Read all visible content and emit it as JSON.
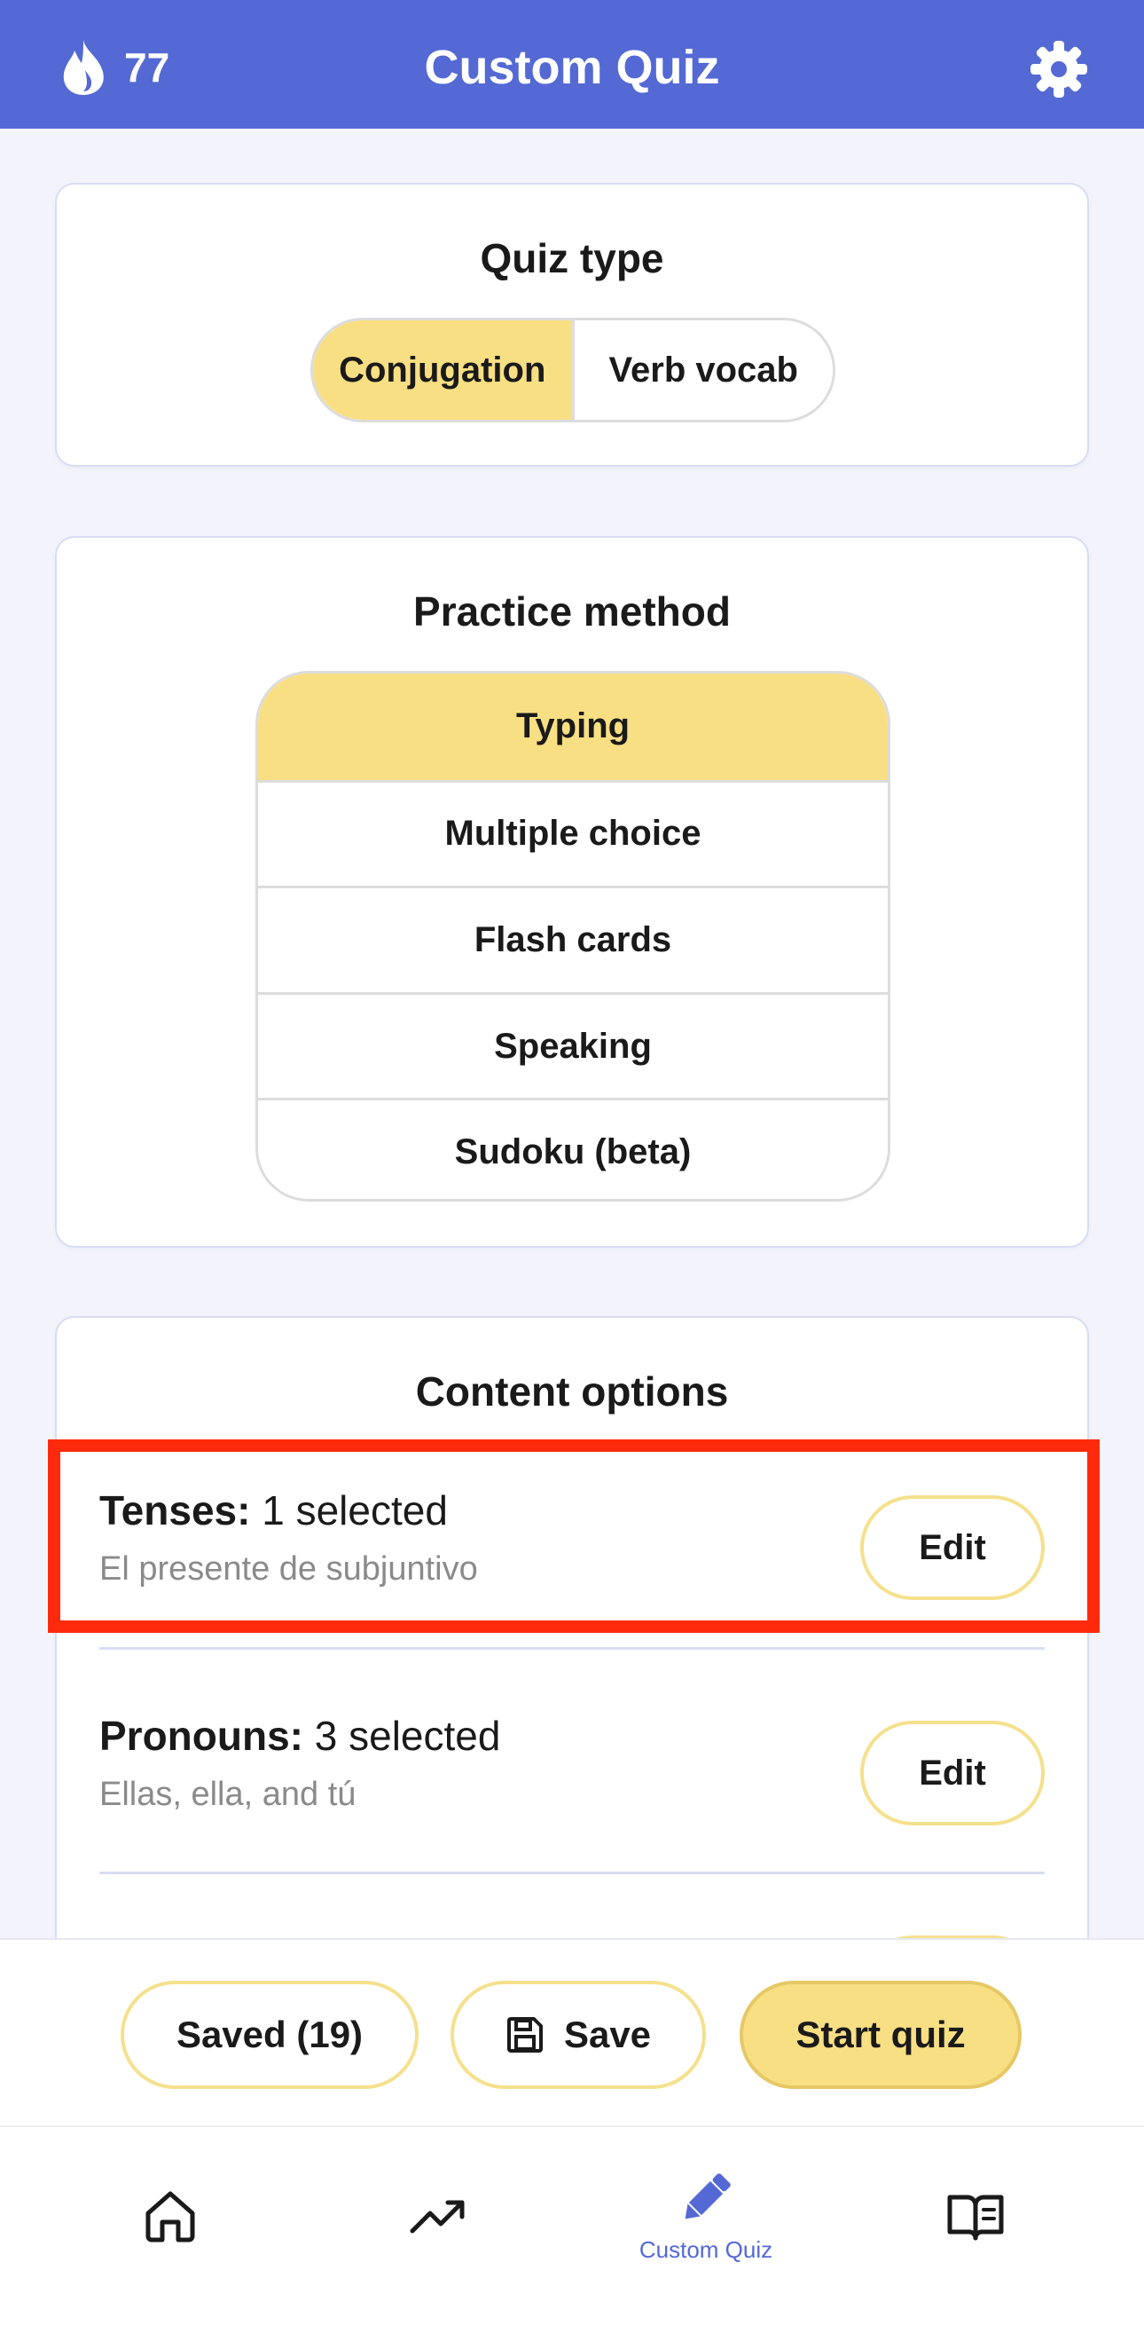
{
  "header": {
    "streak_count": "77",
    "title": "Custom Quiz"
  },
  "quiz_type": {
    "title": "Quiz type",
    "options": [
      "Conjugation",
      "Verb vocab"
    ],
    "selected": "Conjugation"
  },
  "practice_method": {
    "title": "Practice method",
    "options": [
      "Typing",
      "Multiple choice",
      "Flash cards",
      "Speaking",
      "Sudoku (beta)"
    ],
    "selected": "Typing"
  },
  "content_options": {
    "title": "Content options",
    "rows": [
      {
        "label": "Tenses:",
        "count": "1 selected",
        "detail": "El presente de subjuntivo",
        "edit": "Edit"
      },
      {
        "label": "Pronouns:",
        "count": "3 selected",
        "detail": "Ellas, ella, and tú",
        "edit": "Edit"
      }
    ]
  },
  "actions": {
    "saved": "Saved (19)",
    "save": "Save",
    "start": "Start quiz"
  },
  "tabbar": {
    "active_label": "Custom Quiz"
  },
  "colors": {
    "brand": "#5469d4",
    "accent": "#f9df83",
    "highlight": "#ff2a0c"
  },
  "icons": [
    "flame-icon",
    "gear-icon",
    "floppy-disk-icon",
    "home-icon",
    "trending-icon",
    "pencil-icon",
    "book-icon"
  ]
}
